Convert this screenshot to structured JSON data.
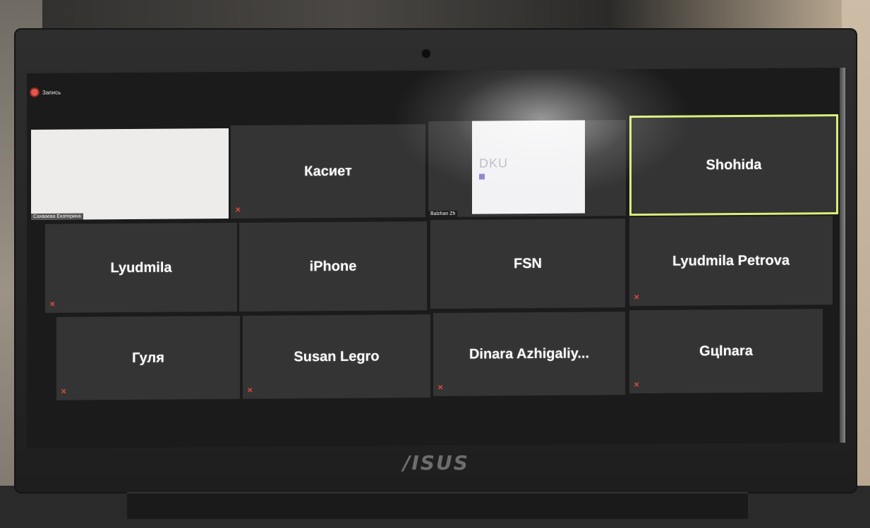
{
  "meeting": {
    "recording_label": "Запись"
  },
  "tiles": [
    {
      "id": "t1",
      "name": "",
      "caption": "Сахваева Екатерина",
      "type": "video"
    },
    {
      "id": "t2",
      "name": "Касиет",
      "caption": "",
      "type": "avatar"
    },
    {
      "id": "t3",
      "name": "",
      "caption": "Balzhan Zh",
      "type": "screen",
      "screen_text": "DKU"
    },
    {
      "id": "t4",
      "name": "Shohida",
      "caption": "",
      "type": "avatar",
      "active": true
    },
    {
      "id": "t5",
      "name": "Lyudmila",
      "caption": "",
      "type": "avatar"
    },
    {
      "id": "t6",
      "name": "iPhone",
      "caption": "",
      "type": "avatar"
    },
    {
      "id": "t7",
      "name": "FSN",
      "caption": "",
      "type": "avatar"
    },
    {
      "id": "t8",
      "name": "Lyudmila Petrova",
      "caption": "",
      "type": "avatar"
    },
    {
      "id": "t9",
      "name": "Гуля",
      "caption": "",
      "type": "avatar"
    },
    {
      "id": "t10",
      "name": "Susan Legro",
      "caption": "",
      "type": "avatar"
    },
    {
      "id": "t11",
      "name": "Dinara  Azhigaliy...",
      "caption": "",
      "type": "avatar"
    },
    {
      "id": "t12",
      "name": "Gцlnara",
      "caption": "",
      "type": "avatar"
    }
  ],
  "device": {
    "brand": "/ISUS"
  },
  "colors": {
    "tile_bg": "#343434",
    "active_speaker_border": "#d8f07a",
    "muted_icon": "#e04b3a",
    "recording_dot": "#e4574b"
  }
}
